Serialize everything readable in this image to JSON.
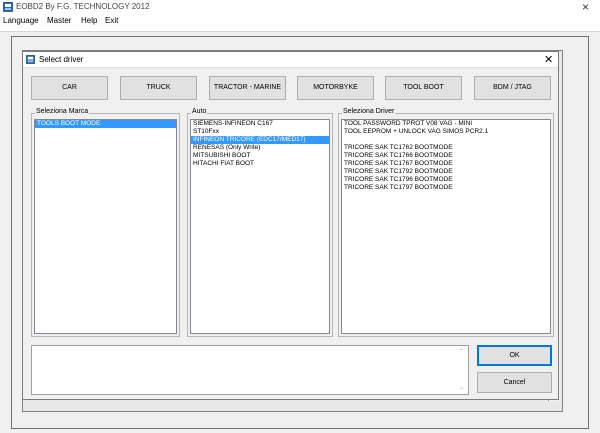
{
  "app": {
    "title": "EOBD2 By F.G. TECHNOLOGY 2012",
    "close_glyph": "×",
    "icon": "app-icon"
  },
  "menu": {
    "items": [
      {
        "label": "Language"
      },
      {
        "label": "Master"
      },
      {
        "label": "Help"
      },
      {
        "label": "Exit"
      }
    ]
  },
  "dialog": {
    "title": "Select driver",
    "close_glyph": "✕",
    "categories": [
      {
        "label": "CAR"
      },
      {
        "label": "TRUCK"
      },
      {
        "label": "TRACTOR - MARINE"
      },
      {
        "label": "MOTORBYKE"
      },
      {
        "label": "TOOL BOOT"
      },
      {
        "label": "BDM / JTAG"
      }
    ],
    "marca": {
      "label": "Seleziona Marca",
      "items": [
        "TOOLS BOOT MODE"
      ],
      "selected_index": 0
    },
    "auto": {
      "label": "Auto",
      "items": [
        "SIEMENS-INFINEON C167",
        "ST10Fxx",
        "INFINEON TRICORE (EDC17/MED17)",
        "RENESAS (Only Write)",
        "MITSUBISHI BOOT",
        "HITACHI FIAT BOOT"
      ],
      "selected_index": 2
    },
    "driver": {
      "label": "Seleziona Driver",
      "items": [
        "TOOL PASSWORD TPROT V08 VAG - MINI",
        "TOOL EEPROM + UNLOCK VAG SIMOS PCR2.1",
        "",
        "TRICORE SAK TC1762  BOOTMODE",
        "TRICORE SAK TC1766  BOOTMODE",
        "TRICORE SAK TC1767  BOOTMODE",
        "TRICORE SAK TC1792  BOOTMODE",
        "TRICORE SAK TC1796  BOOTMODE",
        "TRICORE SAK TC1797  BOOTMODE"
      ]
    },
    "memo": {
      "value": "",
      "scroll_up_glyph": "⌃",
      "scroll_down_glyph": "⌄"
    },
    "ok_label": "OK",
    "cancel_label": "Cancel"
  },
  "colors": {
    "selection": "#3399ff",
    "window_bg": "#f0f0f0",
    "default_button_border": "#0078d7"
  }
}
